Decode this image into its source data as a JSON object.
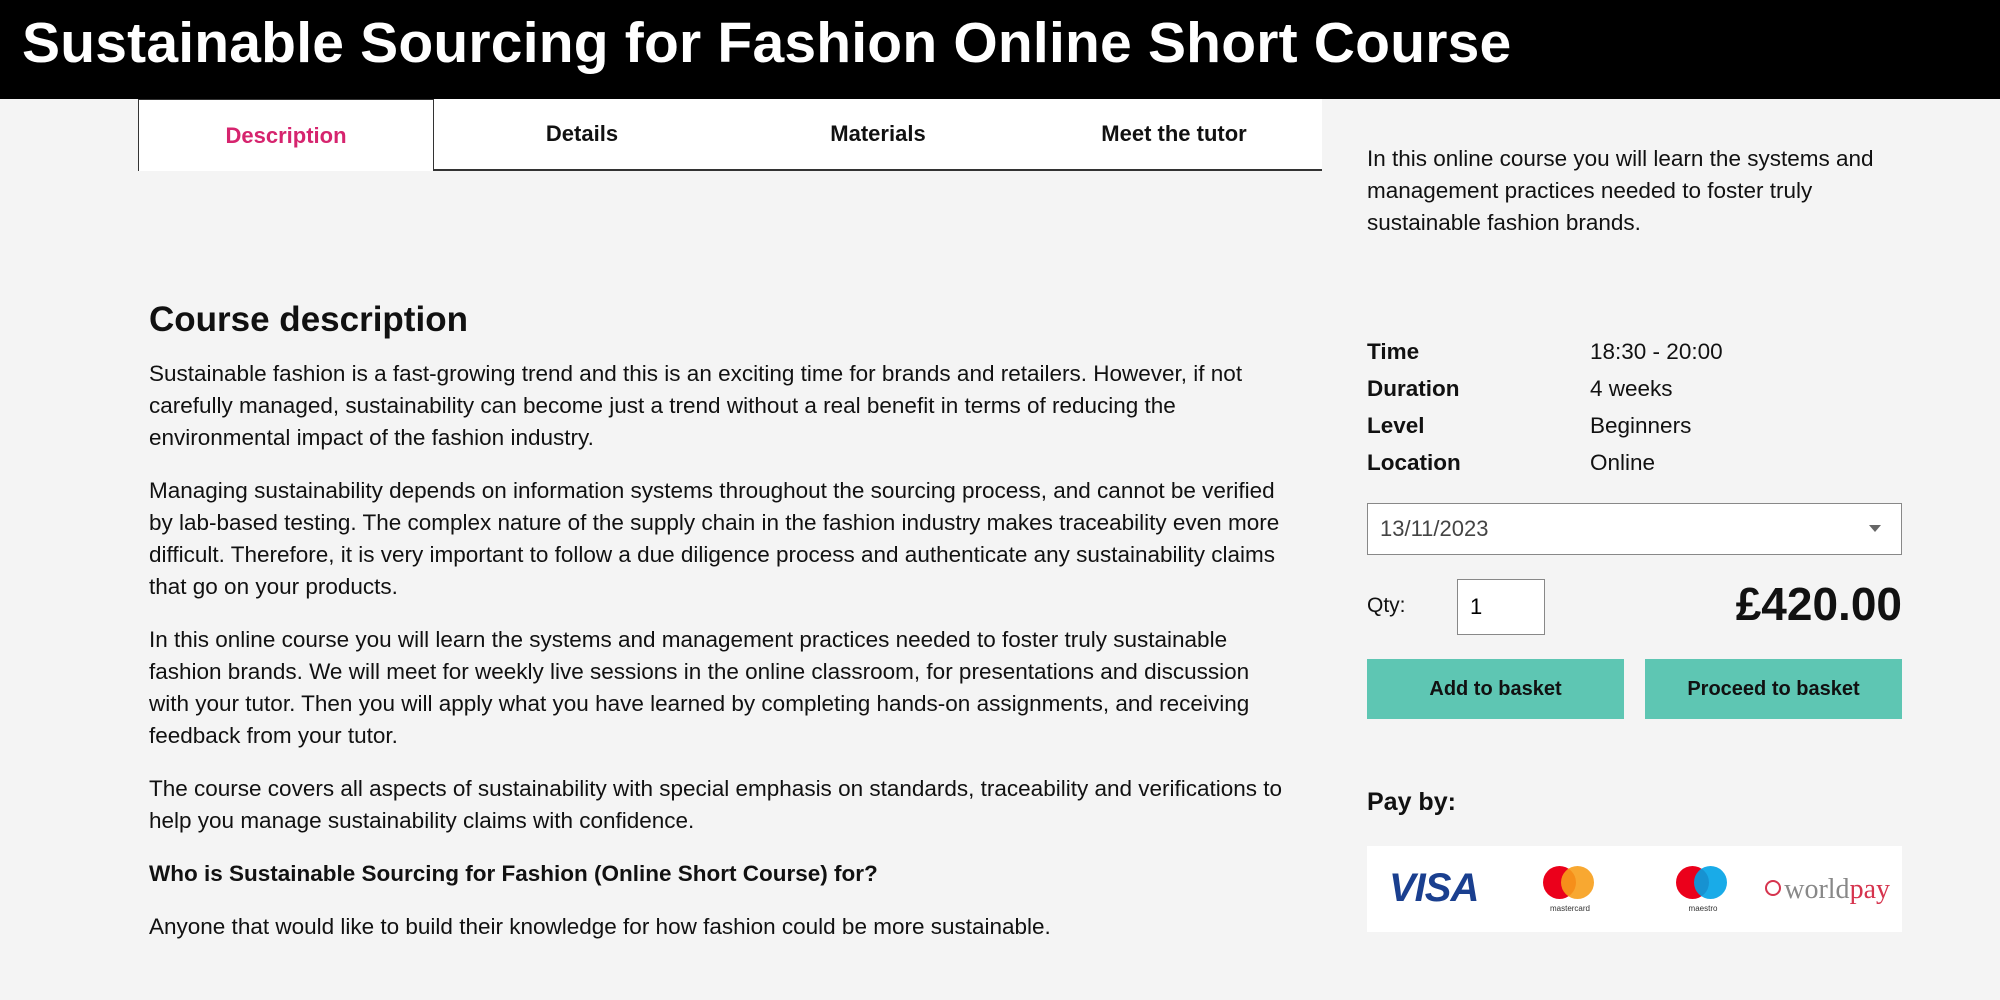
{
  "header": {
    "title": "Sustainable Sourcing for Fashion Online Short Course"
  },
  "tabs": [
    {
      "label": "Description",
      "active": true
    },
    {
      "label": "Details"
    },
    {
      "label": "Materials"
    },
    {
      "label": "Meet the tutor"
    }
  ],
  "main": {
    "heading": "Course description",
    "paragraphs": [
      "Sustainable fashion is a fast-growing trend and this is an exciting time for brands and retailers. However, if not carefully managed, sustainability can become just a trend without a real benefit in terms of reducing the environmental impact of the fashion industry.",
      "Managing sustainability depends on information systems throughout the sourcing process, and cannot be verified by lab-based testing. The complex nature of the supply chain in the fashion industry makes traceability even more difficult. Therefore, it is very important to follow a due diligence process and authenticate any sustainability claims that go on your products.",
      "In this online course you will learn the systems and management practices needed to foster truly sustainable fashion brands. We will meet for weekly live sessions in the online classroom, for presentations and discussion with your tutor. Then you will apply what you have learned by completing hands-on assignments, and receiving feedback from your tutor.",
      "The course covers all aspects of sustainability with special emphasis on standards, traceability and verifications to help you manage sustainability claims with confidence.",
      "Who is Sustainable Sourcing for Fashion (Online Short Course) for?",
      "Anyone that would like to build their knowledge for how fashion could be more sustainable."
    ]
  },
  "sidebar": {
    "intro": "In this online course you will learn the systems and management practices needed to foster truly sustainable fashion brands.",
    "facts": [
      {
        "label": "Time",
        "value": "18:30 - 20:00"
      },
      {
        "label": "Duration",
        "value": "4 weeks"
      },
      {
        "label": "Level",
        "value": "Beginners"
      },
      {
        "label": "Location",
        "value": "Online"
      }
    ],
    "date_selected": "13/11/2023",
    "qty_label": "Qty:",
    "qty_value": "1",
    "price": "£420.00",
    "add_button": "Add to basket",
    "proceed_button": "Proceed to basket",
    "pay_by": "Pay by:",
    "payment_logos": {
      "visa": "VISA",
      "mastercard": "mastercard",
      "maestro": "maestro",
      "worldpay_a": "world",
      "worldpay_b": "pay"
    }
  },
  "colors": {
    "accent_pink": "#d6246e",
    "button_teal": "#5ec6b3",
    "header_bg": "#000000",
    "page_bg": "#f4f4f4"
  }
}
